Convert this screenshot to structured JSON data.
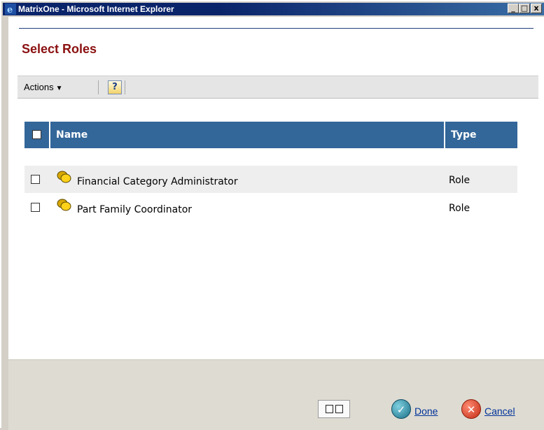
{
  "window": {
    "title": "MatrixOne - Microsoft Internet Explorer",
    "controls": [
      "_",
      "□",
      "x"
    ]
  },
  "page": {
    "title": "Select Roles"
  },
  "toolbar": {
    "actions_label": "Actions",
    "help_label": "?"
  },
  "table": {
    "columns": [
      "Name",
      "Type"
    ],
    "rows": [
      {
        "name": "Financial Category Administrator",
        "type": "Role"
      },
      {
        "name": "Part Family Coordinator",
        "type": "Role"
      }
    ]
  },
  "footer": {
    "done_label": "Done",
    "cancel_label": "Cancel"
  },
  "colors": {
    "title_red": "#8b1010",
    "header_blue": "#336699",
    "link_blue": "#003399"
  }
}
